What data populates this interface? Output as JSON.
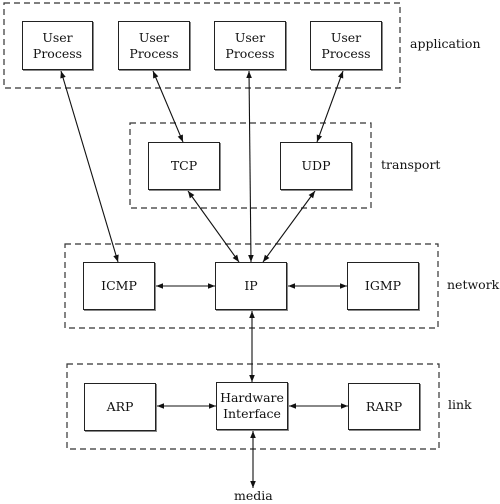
{
  "layers": {
    "application": "application",
    "transport": "transport",
    "network": "network",
    "link": "link"
  },
  "nodes": {
    "up1": "User Process",
    "up2": "User Process",
    "up3": "User Process",
    "up4": "User Process",
    "tcp": "TCP",
    "udp": "UDP",
    "icmp": "ICMP",
    "ip": "IP",
    "igmp": "IGMP",
    "arp": "ARP",
    "hw": "Hardware Interface",
    "rarp": "RARP"
  },
  "media": "media",
  "edges": [
    [
      "up1",
      "icmp"
    ],
    [
      "up2",
      "tcp"
    ],
    [
      "up3",
      "ip"
    ],
    [
      "up4",
      "udp"
    ],
    [
      "tcp",
      "ip"
    ],
    [
      "udp",
      "ip"
    ],
    [
      "icmp",
      "ip"
    ],
    [
      "ip",
      "igmp"
    ],
    [
      "ip",
      "hw"
    ],
    [
      "arp",
      "hw"
    ],
    [
      "hw",
      "rarp"
    ],
    [
      "hw",
      "media"
    ]
  ]
}
